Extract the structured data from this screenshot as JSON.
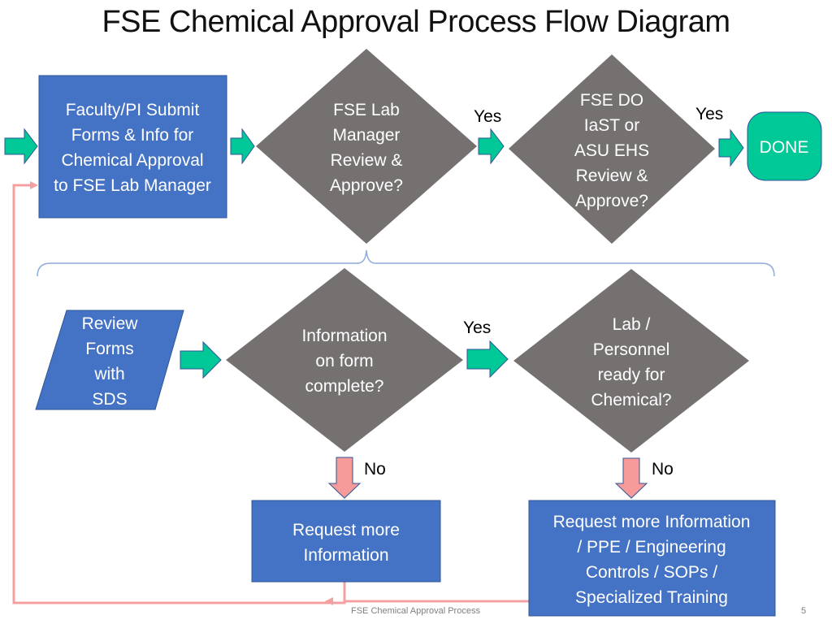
{
  "title": "FSE Chemical Approval Process Flow Diagram",
  "colors": {
    "process_blue": "#4472c4",
    "decision_gray": "#767171",
    "arrow_green": "#00c896",
    "arrow_red": "#f79a9a",
    "feedback_line": "#f4a0a0",
    "brace_blue": "#8faadc"
  },
  "nodes": {
    "submit": {
      "type": "process",
      "lines": [
        "Faculty/PI Submit",
        "Forms & Info for",
        "Chemical Approval",
        "to FSE Lab Manager"
      ]
    },
    "lab_manager_review": {
      "type": "decision",
      "lines": [
        "FSE Lab",
        "Manager",
        "Review &",
        "Approve?"
      ]
    },
    "do_review": {
      "type": "decision",
      "lines": [
        "FSE DO",
        "IaST or",
        "ASU EHS",
        "Review &",
        "Approve?"
      ]
    },
    "done": {
      "type": "terminator",
      "lines": [
        "DONE"
      ]
    },
    "review_forms": {
      "type": "data",
      "lines": [
        "Review",
        "Forms",
        "with",
        "SDS"
      ]
    },
    "info_complete": {
      "type": "decision",
      "lines": [
        "Information",
        "on form",
        "complete?"
      ]
    },
    "lab_ready": {
      "type": "decision",
      "lines": [
        "Lab /",
        "Personnel",
        "ready for",
        "Chemical?"
      ]
    },
    "request_info": {
      "type": "process",
      "lines": [
        "Request more",
        "Information"
      ]
    },
    "request_more": {
      "type": "process",
      "lines": [
        "Request more Information",
        "/ PPE / Engineering",
        "Controls / SOPs /",
        "Specialized Training"
      ]
    }
  },
  "edge_labels": {
    "yes_1": "Yes",
    "yes_2": "Yes",
    "yes_3": "Yes",
    "no_1": "No",
    "no_2": "No"
  },
  "footer": {
    "text": "FSE Chemical Approval Process",
    "page_number": "5"
  }
}
